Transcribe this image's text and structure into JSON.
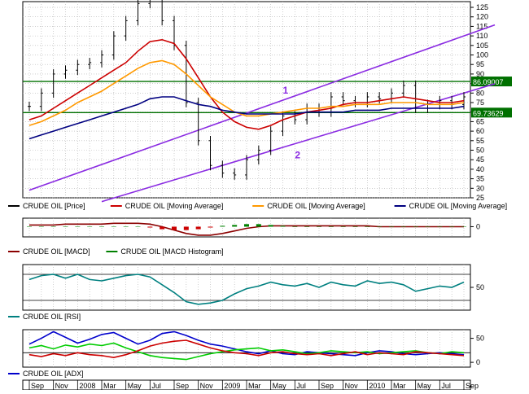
{
  "chart_data": [
    {
      "type": "line",
      "panel": "price",
      "ylim": [
        25,
        128
      ],
      "y_ticks": [
        25,
        30,
        35,
        40,
        45,
        50,
        55,
        60,
        65,
        70,
        75,
        80,
        85,
        90,
        95,
        100,
        105,
        110,
        115,
        120,
        125
      ],
      "grid": true,
      "x": [
        "2007-09",
        "2007-10",
        "2007-11",
        "2007-12",
        "2008-01",
        "2008-02",
        "2008-03",
        "2008-04",
        "2008-05",
        "2008-06",
        "2008-07",
        "2008-08",
        "2008-09",
        "2008-10",
        "2008-11",
        "2008-12",
        "2009-01",
        "2009-02",
        "2009-03",
        "2009-04",
        "2009-05",
        "2009-06",
        "2009-07",
        "2009-08",
        "2009-09",
        "2009-10",
        "2009-11",
        "2009-12",
        "2010-01",
        "2010-02",
        "2010-03",
        "2010-04",
        "2010-05",
        "2010-06",
        "2010-07",
        "2010-08",
        "2010-09"
      ],
      "series": [
        {
          "name": "CRUDE OIL [Price]",
          "style": "ohlc",
          "color": "#000000",
          "values": [
            73,
            80,
            90,
            92,
            95,
            96,
            100,
            110,
            118,
            127,
            130,
            118,
            105,
            75,
            55,
            42,
            38,
            37,
            45,
            50,
            60,
            68,
            66,
            72,
            70,
            78,
            76,
            75,
            78,
            77,
            80,
            84,
            72,
            74,
            76,
            74,
            78
          ]
        },
        {
          "name": "CRUDE OIL [Moving Average]",
          "color": "#cc0000",
          "values": [
            66,
            68,
            72,
            76,
            80,
            84,
            88,
            92,
            96,
            102,
            107,
            108,
            106,
            98,
            88,
            78,
            70,
            65,
            62,
            61,
            63,
            66,
            68,
            70,
            71,
            72,
            74,
            75,
            75,
            76,
            77,
            78,
            77,
            76,
            75,
            75,
            76
          ]
        },
        {
          "name": "CRUDE OIL [Moving Average]",
          "color": "#ff9900",
          "values": [
            63,
            65,
            68,
            71,
            75,
            78,
            81,
            85,
            89,
            93,
            96,
            97,
            95,
            90,
            84,
            78,
            74,
            70,
            68,
            68,
            69,
            70,
            71,
            72,
            72,
            73,
            73,
            74,
            74,
            74,
            75,
            75,
            75,
            74,
            74,
            74,
            75
          ]
        },
        {
          "name": "CRUDE OIL [Moving Average]",
          "color": "#000080",
          "values": [
            56,
            58,
            60,
            62,
            64,
            66,
            68,
            70,
            72,
            74,
            77,
            78,
            78,
            76,
            74,
            73,
            71,
            70,
            69,
            69,
            69,
            69,
            69,
            70,
            70,
            70,
            70,
            71,
            71,
            71,
            72,
            72,
            72,
            72,
            72,
            72,
            73
          ]
        }
      ],
      "horizontal_lines": [
        {
          "value": 86.09007,
          "label": "86.09007",
          "color": "#007000"
        },
        {
          "value": 69.73629,
          "label": "69.73629",
          "color": "#007000"
        }
      ],
      "channel_lines": [
        {
          "label": "1",
          "color": "#8a2be2",
          "points": [
            [
              "2007-09",
              29
            ],
            [
              "2010-09",
              110
            ]
          ]
        },
        {
          "label": "2",
          "color": "#8a2be2",
          "points": [
            [
              "2008-03",
              23
            ],
            [
              "2010-09",
              80
            ]
          ]
        }
      ],
      "legend": [
        "CRUDE OIL [Price]",
        "CRUDE OIL [Moving Average]",
        "CRUDE OIL [Moving Average]",
        "CRUDE OIL [Moving Average]"
      ]
    },
    {
      "type": "line",
      "panel": "macd",
      "ylim": [
        -12,
        10
      ],
      "y_ticks": [
        0
      ],
      "series": [
        {
          "name": "CRUDE OIL [MACD]",
          "color": "#8b0000",
          "values": [
            2,
            2,
            2,
            3,
            3,
            3,
            3,
            4,
            4,
            4,
            3,
            0,
            -4,
            -8,
            -10,
            -10,
            -8,
            -5,
            -2,
            0,
            1,
            1,
            1,
            1,
            1,
            1,
            1,
            1,
            1,
            0,
            0,
            0,
            0,
            0,
            0,
            0,
            0
          ]
        },
        {
          "name": "CRUDE OIL [MACD Histogram]",
          "style": "bars",
          "color": "#008000",
          "negative_color": "#cc0000",
          "values": [
            0,
            0,
            0,
            0,
            0,
            0,
            0,
            0,
            0,
            0,
            -1,
            -3,
            -4,
            -4,
            -3,
            -1,
            1,
            2,
            3,
            3,
            2,
            1,
            0,
            0,
            0,
            0,
            0,
            0,
            0,
            0,
            0,
            0,
            0,
            0,
            0,
            0,
            0
          ]
        }
      ],
      "legend": [
        "CRUDE OIL [MACD]",
        "CRUDE OIL [MACD Histogram]"
      ]
    },
    {
      "type": "line",
      "panel": "rsi",
      "ylim": [
        15,
        85
      ],
      "y_ticks": [
        50
      ],
      "reference_lines": [
        30,
        70
      ],
      "series": [
        {
          "name": "CRUDE OIL [RSI]",
          "color": "#008080",
          "values": [
            62,
            68,
            70,
            64,
            70,
            62,
            60,
            64,
            68,
            70,
            66,
            54,
            42,
            28,
            24,
            26,
            30,
            40,
            48,
            52,
            58,
            54,
            52,
            56,
            50,
            58,
            54,
            52,
            60,
            56,
            58,
            54,
            44,
            48,
            52,
            50,
            58
          ]
        }
      ],
      "legend": [
        "CRUDE OIL [RSI]"
      ]
    },
    {
      "type": "line",
      "panel": "adx",
      "ylim": [
        -10,
        68
      ],
      "y_ticks": [
        0,
        50
      ],
      "reference_lines": [
        20
      ],
      "series": [
        {
          "name": "CRUDE OIL [ADX]",
          "color": "#0000cc",
          "values": [
            38,
            50,
            64,
            52,
            40,
            48,
            58,
            62,
            50,
            38,
            46,
            60,
            64,
            56,
            46,
            38,
            34,
            28,
            22,
            18,
            24,
            18,
            16,
            22,
            20,
            18,
            16,
            14,
            20,
            24,
            22,
            18,
            16,
            18,
            20,
            18,
            16
          ]
        },
        {
          "name": "",
          "color": "#00cc00",
          "values": [
            30,
            35,
            28,
            36,
            32,
            38,
            35,
            40,
            30,
            22,
            14,
            10,
            8,
            6,
            12,
            18,
            22,
            26,
            28,
            30,
            24,
            26,
            22,
            18,
            20,
            24,
            22,
            20,
            22,
            18,
            20,
            22,
            24,
            20,
            18,
            22,
            20
          ]
        },
        {
          "name": "",
          "color": "#cc0000",
          "values": [
            16,
            12,
            18,
            14,
            20,
            16,
            14,
            10,
            16,
            24,
            34,
            40,
            44,
            46,
            38,
            30,
            24,
            20,
            18,
            14,
            20,
            22,
            18,
            16,
            18,
            14,
            18,
            22,
            16,
            20,
            18,
            16,
            22,
            20,
            18,
            16,
            14
          ]
        }
      ],
      "legend": [
        "CRUDE OIL [ADX]"
      ]
    }
  ],
  "x_axis_labels": [
    "Sep",
    "Nov",
    "2008",
    "Mar",
    "May",
    "Jul",
    "Sep",
    "Nov",
    "2009",
    "Mar",
    "May",
    "Jul",
    "Sep",
    "Nov",
    "2010",
    "Mar",
    "May",
    "Jul",
    "Sep"
  ]
}
